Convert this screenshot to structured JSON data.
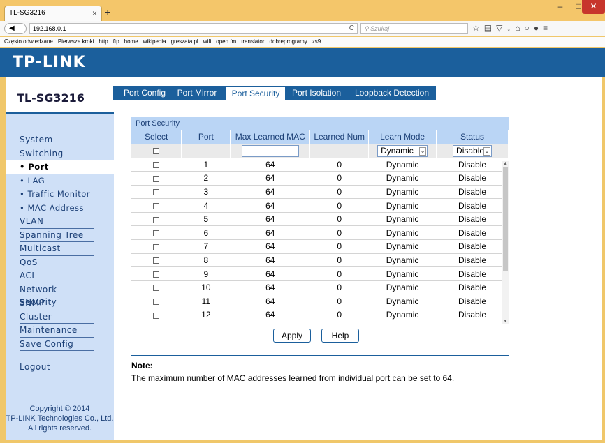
{
  "browser": {
    "tab_title": "TL-SG3216",
    "url": "192.168.0.1",
    "search_placeholder": "Szukaj",
    "bookmarks": [
      "Często odwiedzane",
      "Pierwsze kroki",
      "http",
      "ftp",
      "home",
      "wikipedia",
      "greszata.pl",
      "wifi",
      "open.fm",
      "translator",
      "dobreprogramy",
      "zs9"
    ]
  },
  "brand": {
    "logo": "TP-LINK",
    "model": "TL-SG3216"
  },
  "sidebar": {
    "items": [
      {
        "label": "System"
      },
      {
        "label": "Switching"
      },
      {
        "label": "• Port"
      },
      {
        "label": "• LAG"
      },
      {
        "label": "• Traffic Monitor"
      },
      {
        "label": "• MAC Address"
      },
      {
        "label": "VLAN"
      },
      {
        "label": "Spanning Tree"
      },
      {
        "label": "Multicast"
      },
      {
        "label": "QoS"
      },
      {
        "label": "ACL"
      },
      {
        "label": "Network Security"
      },
      {
        "label": "SNMP"
      },
      {
        "label": "Cluster"
      },
      {
        "label": "Maintenance"
      },
      {
        "label": "Save Config"
      }
    ],
    "logout": "Logout",
    "copyright": "Copyright © 2014\nTP-LINK Technologies Co., Ltd. All rights reserved."
  },
  "tabs": [
    {
      "label": "Port Config"
    },
    {
      "label": "Port Mirror"
    },
    {
      "label": "Port Security"
    },
    {
      "label": "Port Isolation"
    },
    {
      "label": "Loopback Detection"
    }
  ],
  "port_security": {
    "section_title": "Port Security",
    "columns": [
      "Select",
      "Port",
      "Max Learned MAC",
      "Learned Num",
      "Learn Mode",
      "Status"
    ],
    "filter": {
      "learn_mode": "Dynamic",
      "status": "Disable"
    },
    "rows": [
      {
        "port": "1",
        "max": "64",
        "learned": "0",
        "mode": "Dynamic",
        "status": "Disable"
      },
      {
        "port": "2",
        "max": "64",
        "learned": "0",
        "mode": "Dynamic",
        "status": "Disable"
      },
      {
        "port": "3",
        "max": "64",
        "learned": "0",
        "mode": "Dynamic",
        "status": "Disable"
      },
      {
        "port": "4",
        "max": "64",
        "learned": "0",
        "mode": "Dynamic",
        "status": "Disable"
      },
      {
        "port": "5",
        "max": "64",
        "learned": "0",
        "mode": "Dynamic",
        "status": "Disable"
      },
      {
        "port": "6",
        "max": "64",
        "learned": "0",
        "mode": "Dynamic",
        "status": "Disable"
      },
      {
        "port": "7",
        "max": "64",
        "learned": "0",
        "mode": "Dynamic",
        "status": "Disable"
      },
      {
        "port": "8",
        "max": "64",
        "learned": "0",
        "mode": "Dynamic",
        "status": "Disable"
      },
      {
        "port": "9",
        "max": "64",
        "learned": "0",
        "mode": "Dynamic",
        "status": "Disable"
      },
      {
        "port": "10",
        "max": "64",
        "learned": "0",
        "mode": "Dynamic",
        "status": "Disable"
      },
      {
        "port": "11",
        "max": "64",
        "learned": "0",
        "mode": "Dynamic",
        "status": "Disable"
      },
      {
        "port": "12",
        "max": "64",
        "learned": "0",
        "mode": "Dynamic",
        "status": "Disable"
      }
    ],
    "apply_label": "Apply",
    "help_label": "Help"
  },
  "note": {
    "title": "Note:",
    "text": "The maximum number of MAC addresses learned from individual port can be set to 64."
  }
}
